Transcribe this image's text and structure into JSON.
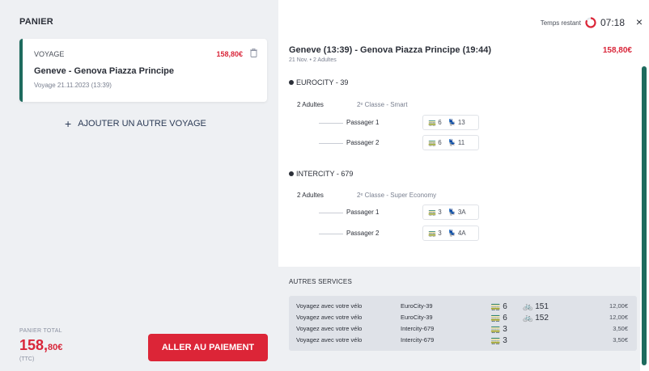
{
  "cart": {
    "title": "PANIER",
    "trip": {
      "label": "VOYAGE",
      "price": "158,80€",
      "route": "Geneve - Genova Piazza Principe",
      "date": "Voyage 21.11.2023 (13:39)"
    },
    "add_trip": "AJOUTER UN AUTRE VOYAGE",
    "total_label": "PANIER TOTAL",
    "total_main": "158,",
    "total_cents": "80€",
    "total_ttc": "(TTC)",
    "pay_button": "ALLER AU PAIEMENT"
  },
  "timer": {
    "label": "Temps restant",
    "value": "07:18"
  },
  "close": "×",
  "journey": {
    "title": "Geneve (13:39) - Genova Piazza Principe (19:44)",
    "subtitle": "21 Nov. • 2 Adultes",
    "price": "158,80€"
  },
  "trains": [
    {
      "name": "EUROCITY - 39",
      "adults": "2 Adultes",
      "classe": "2ᵉ Classe - Smart",
      "passengers": [
        {
          "label": "Passager 1",
          "car": "6",
          "seat": "13"
        },
        {
          "label": "Passager 2",
          "car": "6",
          "seat": "11"
        }
      ]
    },
    {
      "name": "INTERCITY - 679",
      "adults": "2 Adultes",
      "classe": "2ᵉ Classe - Super Economy",
      "passengers": [
        {
          "label": "Passager 1",
          "car": "3",
          "seat": "3A"
        },
        {
          "label": "Passager 2",
          "car": "3",
          "seat": "4A"
        }
      ]
    }
  ],
  "services": {
    "title": "AUTRES SERVICES",
    "rows": [
      {
        "desc": "Voyagez avec votre vélo",
        "train": "EuroCity-39",
        "car": "6",
        "bike": "151",
        "price": "12,00€"
      },
      {
        "desc": "Voyagez avec votre vélo",
        "train": "EuroCity-39",
        "car": "6",
        "bike": "152",
        "price": "12,00€"
      },
      {
        "desc": "Voyagez avec votre vélo",
        "train": "Intercity-679",
        "car": "3",
        "bike": "",
        "price": "3,50€"
      },
      {
        "desc": "Voyagez avec votre vélo",
        "train": "Intercity-679",
        "car": "3",
        "bike": "",
        "price": "3,50€"
      }
    ]
  },
  "icons": {
    "car": "🚃",
    "seat": "💺",
    "bike": "🚲",
    "trash": "trash-icon",
    "timer": "timer-icon"
  },
  "colors": {
    "accent_red": "#dc2537",
    "accent_green": "#1e6b5e",
    "panel_bg": "#eef0f3"
  }
}
